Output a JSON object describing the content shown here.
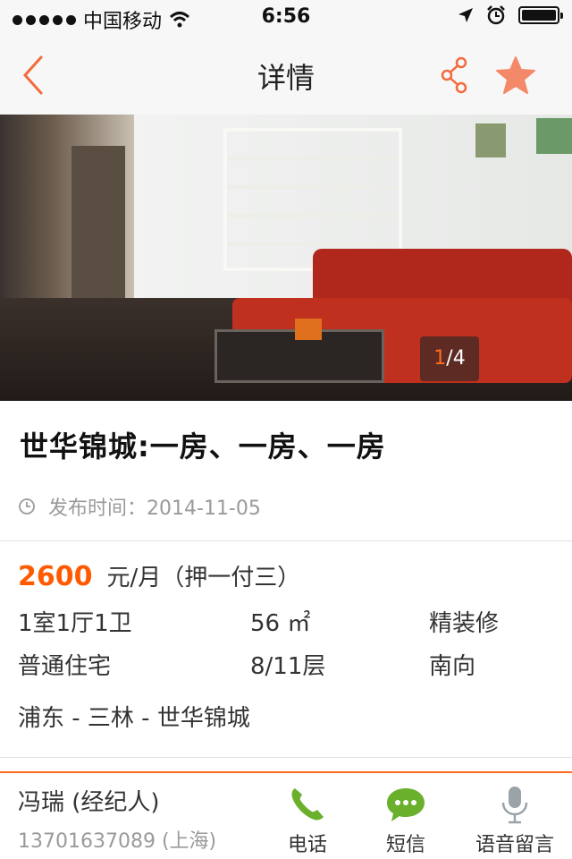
{
  "status_bar": {
    "carrier": "中国移动",
    "time": "6:56"
  },
  "nav": {
    "title": "详情",
    "back_icon": "chevron-left-icon",
    "share_icon": "share-icon",
    "favorite_icon": "star-icon",
    "accent_color": "#f26a3d"
  },
  "gallery": {
    "current": "1",
    "total": "/4",
    "current_index": 1,
    "total_count": 4
  },
  "listing": {
    "title": "世华锦城:一房、一房、一房",
    "publish_label": "发布时间：",
    "publish_date": "2014-11-05",
    "price": "2600",
    "price_unit": "元/月（押一付三）",
    "price_color": "#ff5a00",
    "rooms": "1室1厅1卫",
    "area": "56 ㎡",
    "decoration": "精装修",
    "type": "普通住宅",
    "floor": "8/11层",
    "orientation": "南向",
    "location": "浦东 - 三林 - 世华锦城"
  },
  "contact": {
    "agent_name": "冯瑞 (经纪人)",
    "agent_phone": "13701637089 (上海)",
    "actions": [
      {
        "label": "电话",
        "icon": "phone-icon",
        "color": "#6ab02c"
      },
      {
        "label": "短信",
        "icon": "chat-bubble-icon",
        "color": "#6ab02c"
      },
      {
        "label": "语音留言",
        "icon": "microphone-icon",
        "color": "#9aa3a8"
      }
    ]
  }
}
